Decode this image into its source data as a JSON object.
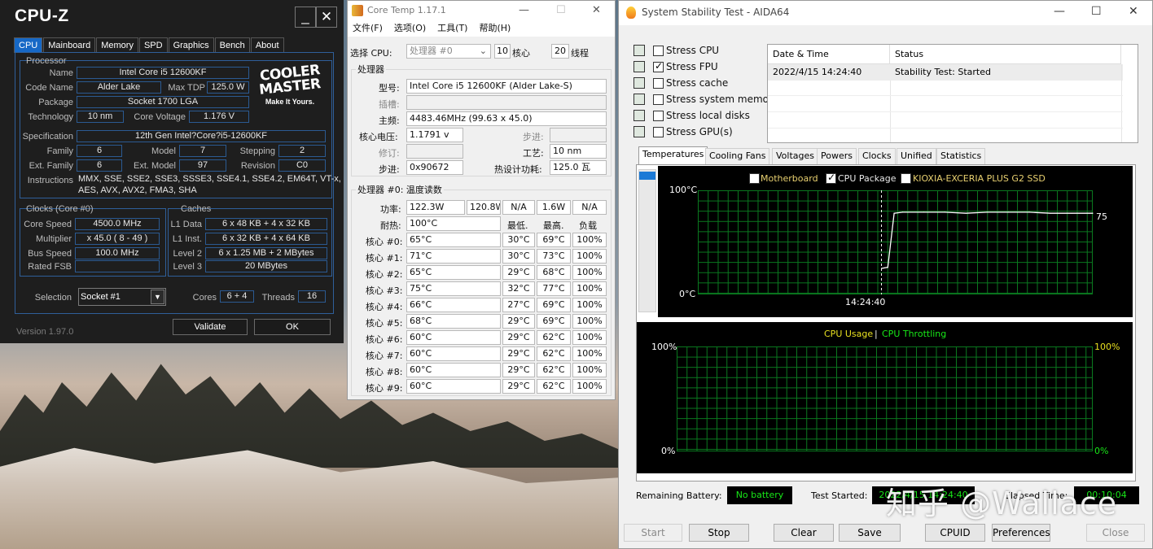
{
  "cpuz": {
    "title": "CPU-Z",
    "minimize": "_",
    "close": "✕",
    "tabs": [
      "CPU",
      "Mainboard",
      "Memory",
      "SPD",
      "Graphics",
      "Bench",
      "About"
    ],
    "processor_header": "Processor",
    "name_label": "Name",
    "name": "Intel Core i5 12600KF",
    "codename_label": "Code Name",
    "codename": "Alder Lake",
    "maxtdp_label": "Max TDP",
    "maxtdp": "125.0 W",
    "package_label": "Package",
    "package": "Socket 1700 LGA",
    "technology_label": "Technology",
    "technology": "10 nm",
    "corevoltage_label": "Core Voltage",
    "corevoltage": "1.176 V",
    "spec_label": "Specification",
    "spec": "12th Gen Intel?Core?i5-12600KF",
    "family_label": "Family",
    "family": "6",
    "model_label": "Model",
    "model": "7",
    "stepping_label": "Stepping",
    "stepping": "2",
    "extfamily_label": "Ext. Family",
    "extfamily": "6",
    "extmodel_label": "Ext. Model",
    "extmodel": "97",
    "revision_label": "Revision",
    "revision": "C0",
    "instructions_label": "Instructions",
    "instructions_l1": "MMX, SSE, SSE2, SSE3, SSSE3, SSE4.1, SSE4.2, EM64T, VT-x,",
    "instructions_l2": "AES, AVX, AVX2, FMA3, SHA",
    "clocks_header": "Clocks (Core #0)",
    "caches_header": "Caches",
    "corespeed_label": "Core Speed",
    "corespeed": "4500.0 MHz",
    "multiplier_label": "Multiplier",
    "multiplier": "x 45.0 ( 8 - 49 )",
    "busspeed_label": "Bus Speed",
    "busspeed": "100.0 MHz",
    "ratedfsb_label": "Rated FSB",
    "l1data_label": "L1 Data",
    "l1data": "6 x 48 KB + 4 x 32 KB",
    "l1inst_label": "L1 Inst.",
    "l1inst": "6 x 32 KB + 4 x 64 KB",
    "level2_label": "Level 2",
    "level2": "6 x 1.25 MB + 2 MBytes",
    "level3_label": "Level 3",
    "level3": "20 MBytes",
    "selection_label": "Selection",
    "selection": "Socket #1",
    "cores_label": "Cores",
    "cores": "6 + 4",
    "threads_label": "Threads",
    "threads": "16",
    "version": "Version 1.97.0",
    "validate": "Validate",
    "ok": "OK",
    "logo_l1": "COOLER",
    "logo_l2": "MASTER",
    "logo_l3": "Make It Yours."
  },
  "coretemp": {
    "title": "Core Temp 1.17.1",
    "menu": [
      "文件(F)",
      "选项(O)",
      "工具(T)",
      "帮助(H)"
    ],
    "select_cpu_label": "选择 CPU:",
    "select_cpu_value": "处理器 #0",
    "cores_value": "10",
    "cores_label": "核心",
    "threads_value": "20",
    "threads_label": "线程",
    "processor_header": "处理器",
    "model_label": "型号:",
    "model": "Intel Core i5 12600KF (Alder Lake-S)",
    "socket_label": "插槽:",
    "freq_label": "主频:",
    "freq": "4483.46MHz (99.63 x 45.0)",
    "vid_label": "核心电压:",
    "vid": "1.1791 v",
    "stepping_label": "步进:",
    "revision_label": "修订:",
    "lithography_label": "工艺:",
    "lithography": "10 nm",
    "cpuid_label": "步进:",
    "cpuid": "0x90672",
    "tdp_label": "热设计功耗:",
    "tdp": "125.0 瓦",
    "readings_header": "处理器 #0: 温度读数",
    "power_label": "功率:",
    "power": [
      "122.3W",
      "120.8W",
      "N/A",
      "1.6W",
      "N/A"
    ],
    "tjmax_label": "耐热:",
    "tjmax": "100°C",
    "min_label": "最低.",
    "max_label": "最高.",
    "load_label": "负载",
    "cores": [
      {
        "label": "核心 #0:",
        "temp": "65°C",
        "min": "30°C",
        "max": "69°C",
        "load": "100%"
      },
      {
        "label": "核心 #1:",
        "temp": "71°C",
        "min": "30°C",
        "max": "73°C",
        "load": "100%"
      },
      {
        "label": "核心 #2:",
        "temp": "65°C",
        "min": "29°C",
        "max": "68°C",
        "load": "100%"
      },
      {
        "label": "核心 #3:",
        "temp": "75°C",
        "min": "32°C",
        "max": "77°C",
        "load": "100%"
      },
      {
        "label": "核心 #4:",
        "temp": "66°C",
        "min": "27°C",
        "max": "69°C",
        "load": "100%"
      },
      {
        "label": "核心 #5:",
        "temp": "68°C",
        "min": "29°C",
        "max": "69°C",
        "load": "100%"
      },
      {
        "label": "核心 #6:",
        "temp": "60°C",
        "min": "29°C",
        "max": "62°C",
        "load": "100%"
      },
      {
        "label": "核心 #7:",
        "temp": "60°C",
        "min": "29°C",
        "max": "62°C",
        "load": "100%"
      },
      {
        "label": "核心 #8:",
        "temp": "60°C",
        "min": "29°C",
        "max": "62°C",
        "load": "100%"
      },
      {
        "label": "核心 #9:",
        "temp": "60°C",
        "min": "29°C",
        "max": "62°C",
        "load": "100%"
      }
    ]
  },
  "aida": {
    "title": "System Stability Test - AIDA64",
    "stress_items": [
      {
        "label": "Stress CPU",
        "checked": false,
        "icon": "cpu-chip-icon"
      },
      {
        "label": "Stress FPU",
        "checked": true,
        "icon": "fpu-chip-icon"
      },
      {
        "label": "Stress cache",
        "checked": false,
        "icon": "cache-chip-icon"
      },
      {
        "label": "Stress system memory",
        "checked": false,
        "icon": "memory-module-icon"
      },
      {
        "label": "Stress local disks",
        "checked": false,
        "icon": "disk-drive-icon"
      },
      {
        "label": "Stress GPU(s)",
        "checked": false,
        "icon": "monitor-icon"
      }
    ],
    "log_headers": [
      "Date & Time",
      "Status"
    ],
    "log_rows": [
      {
        "time": "2022/4/15 14:24:40",
        "status": "Stability Test: Started"
      }
    ],
    "tabs": [
      "Temperatures",
      "Cooling Fans",
      "Voltages",
      "Powers",
      "Clocks",
      "Unified",
      "Statistics"
    ],
    "temp_legend": [
      "Motherboard",
      "CPU Package",
      "KIOXIA-EXCERIA PLUS G2 SSD"
    ],
    "temp_legend_checked": [
      false,
      true,
      false
    ],
    "temp_y_top": "100°C",
    "temp_y_bottom": "0°C",
    "temp_x_label": "14:24:40",
    "temp_current": "75",
    "usage_title_a": "CPU Usage",
    "usage_sep": "|",
    "usage_title_b": "CPU Throttling",
    "usage_left_top": "100%",
    "usage_left_bottom": "0%",
    "usage_right_top": "100%",
    "usage_right_bottom": "0%",
    "battery_label": "Remaining Battery:",
    "battery_value": "No battery",
    "test_started_label": "Test Started:",
    "test_started_value": "2022/4/15 14:24:40",
    "elapsed_label": "Elapsed Time:",
    "elapsed_value": "00:10:04",
    "buttons": [
      "Start",
      "Stop",
      "Clear",
      "Save",
      "CPUID",
      "Preferences",
      "Close"
    ]
  },
  "chart_data": [
    {
      "type": "line",
      "title": "",
      "series": [
        {
          "name": "CPU Package",
          "color": "#ffffff",
          "x": [
            0,
            0.03,
            0.06,
            0.1,
            0.2,
            0.3,
            0.4,
            0.5,
            0.6,
            0.7,
            0.8,
            0.9,
            1.0
          ],
          "y": [
            25,
            26,
            78,
            79,
            79,
            79,
            78,
            79,
            79,
            79,
            78,
            78,
            78
          ]
        }
      ],
      "xlabel": "",
      "ylabel": "",
      "ylim": [
        0,
        100
      ],
      "grid": true
    }
  ],
  "watermark": "知乎 @Wallace"
}
